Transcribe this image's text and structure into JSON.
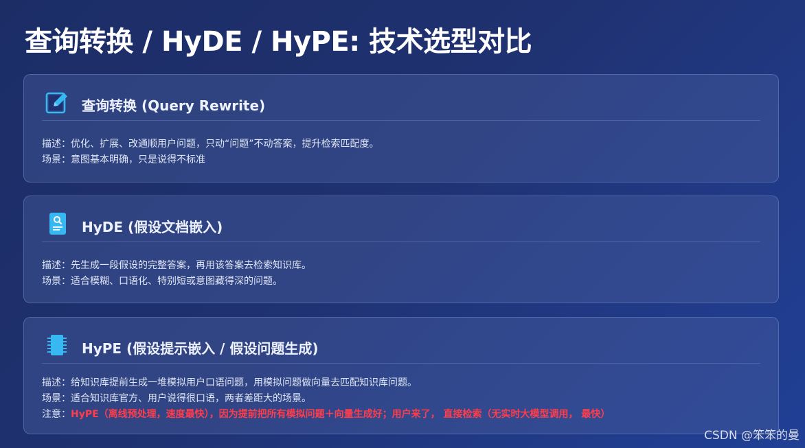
{
  "page": {
    "title": "查询转换 / HyDE / HyPE: 技术选型对比"
  },
  "cards": [
    {
      "icon": "edit-icon",
      "title": "查询转换 (Query Rewrite)",
      "description": "描述：优化、扩展、改通顺用户问题，只动“问题”不动答案，提升检索匹配度。",
      "scenario": "场景：意图基本明确，只是说得不标准"
    },
    {
      "icon": "document-search-icon",
      "title": "HyDE (假设文档嵌入)",
      "description": "描述：先生成一段假设的完整答案，再用该答案去检索知识库。",
      "scenario": "场景：适合模糊、口语化、特别短或意图藏得深的问题。"
    },
    {
      "icon": "chip-icon",
      "title": "HyPE (假设提示嵌入 / 假设问题生成)",
      "description": "描述：给知识库提前生成一堆模拟用户口语问题，用模拟问题做向量去匹配知识库问题。",
      "scenario": "场景：适合知识库官方、用户说得很口语，两者差距大的场景。",
      "note_label": "注意：",
      "note_text": "HyPE（离线预处理，速度最快），因为提前把所有模拟问题＋向量生成好；用户来了， 直接检索（无实时大模型调用， 最快）"
    }
  ],
  "watermark": "CSDN @笨笨的曼",
  "colors": {
    "background": "#1f3170",
    "card": "#3a4f8f",
    "icon_accent": "#38b8f2",
    "warning": "#ff3d4a"
  }
}
